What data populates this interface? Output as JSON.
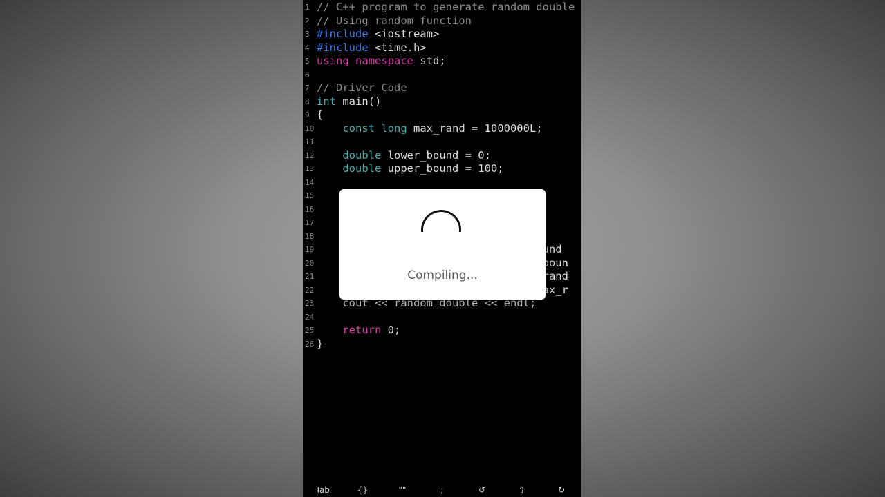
{
  "editor": {
    "lines": [
      {
        "num": "1",
        "tokens": [
          {
            "t": "// C++ program to generate random double",
            "c": "comment"
          }
        ]
      },
      {
        "num": "2",
        "tokens": [
          {
            "t": "// Using random function",
            "c": "comment"
          }
        ]
      },
      {
        "num": "3",
        "tokens": [
          {
            "t": "#include",
            "c": "directive"
          },
          {
            "t": " <iostream>",
            "c": "plain"
          }
        ]
      },
      {
        "num": "4",
        "tokens": [
          {
            "t": "#include",
            "c": "directive"
          },
          {
            "t": " <time.h>",
            "c": "plain"
          }
        ]
      },
      {
        "num": "5",
        "tokens": [
          {
            "t": "using",
            "c": "keyword"
          },
          {
            "t": " ",
            "c": "plain"
          },
          {
            "t": "namespace",
            "c": "keyword"
          },
          {
            "t": " std;",
            "c": "plain"
          }
        ]
      },
      {
        "num": "6",
        "tokens": []
      },
      {
        "num": "7",
        "tokens": [
          {
            "t": "// Driver Code",
            "c": "comment"
          }
        ]
      },
      {
        "num": "8",
        "tokens": [
          {
            "t": "int",
            "c": "type"
          },
          {
            "t": " main()",
            "c": "plain"
          }
        ]
      },
      {
        "num": "9",
        "tokens": [
          {
            "t": "{",
            "c": "plain"
          }
        ]
      },
      {
        "num": "10",
        "tokens": [
          {
            "t": "    ",
            "c": "plain"
          },
          {
            "t": "const",
            "c": "type"
          },
          {
            "t": " ",
            "c": "plain"
          },
          {
            "t": "long",
            "c": "type"
          },
          {
            "t": " max_rand = 1000000L;",
            "c": "plain"
          }
        ]
      },
      {
        "num": "11",
        "tokens": []
      },
      {
        "num": "12",
        "tokens": [
          {
            "t": "    ",
            "c": "plain"
          },
          {
            "t": "double",
            "c": "type"
          },
          {
            "t": " lower_bound = 0;",
            "c": "plain"
          }
        ]
      },
      {
        "num": "13",
        "tokens": [
          {
            "t": "    ",
            "c": "plain"
          },
          {
            "t": "double",
            "c": "type"
          },
          {
            "t": " upper_bound = 100;",
            "c": "plain"
          }
        ]
      },
      {
        "num": "14",
        "tokens": []
      },
      {
        "num": "15",
        "tokens": []
      },
      {
        "num": "16",
        "tokens": []
      },
      {
        "num": "17",
        "tokens": []
      },
      {
        "num": "18",
        "tokens": []
      },
      {
        "num": "19",
        "tokens": [
          {
            "t": "                                  ound",
            "c": "plain"
          }
        ]
      },
      {
        "num": "20",
        "tokens": [
          {
            "t": "                                 r_boun",
            "c": "plain"
          }
        ]
      },
      {
        "num": "21",
        "tokens": [
          {
            "t": "                                  (rand",
            "c": "plain"
          }
        ]
      },
      {
        "num": "22",
        "tokens": [
          {
            "t": "                                  max_r",
            "c": "plain"
          }
        ]
      },
      {
        "num": "23",
        "tokens": [
          {
            "t": "    cout << random_double << endl;",
            "c": "plain"
          }
        ]
      },
      {
        "num": "24",
        "tokens": []
      },
      {
        "num": "25",
        "tokens": [
          {
            "t": "    ",
            "c": "plain"
          },
          {
            "t": "return",
            "c": "keyword"
          },
          {
            "t": " 0;",
            "c": "plain"
          }
        ]
      },
      {
        "num": "26",
        "tokens": [
          {
            "t": "}",
            "c": "plain"
          }
        ]
      }
    ]
  },
  "dialog": {
    "message": "Compiling..."
  },
  "keybar": {
    "keys": [
      {
        "label": "Tab",
        "icon": "tab-key"
      },
      {
        "label": "{}",
        "icon": "braces-key"
      },
      {
        "label": "\"\"",
        "icon": "quotes-key"
      },
      {
        "label": ";",
        "icon": "semicolon-key"
      },
      {
        "label": "↺",
        "icon": "undo-icon"
      },
      {
        "label": "⇧",
        "icon": "shift-icon"
      },
      {
        "label": "↻",
        "icon": "redo-icon"
      }
    ]
  },
  "colors": {
    "comment": "#8a8a8a",
    "directive": "#3b78e7",
    "keyword": "#d13ba3",
    "type": "#4aa9a9",
    "plain": "#dcdcdc",
    "editor_bg": "#000000",
    "dialog_bg": "#ffffff"
  }
}
